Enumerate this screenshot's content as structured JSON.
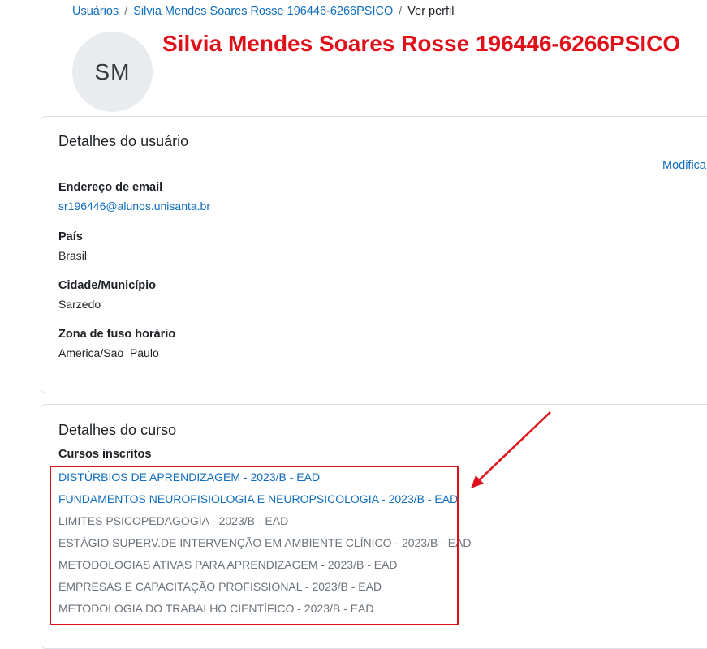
{
  "breadcrumb": {
    "items": [
      "Usuários",
      "Silvia Mendes Soares Rosse 196446-6266PSICO",
      "Ver perfil"
    ]
  },
  "profile": {
    "initials": "SM",
    "headline": "Silvia Mendes Soares Rosse 196446-6266PSICO"
  },
  "user_details": {
    "title": "Detalhes do usuário",
    "edit_label": "Modificar",
    "fields": [
      {
        "label": "Endereço de email",
        "value": "sr196446@alunos.unisanta.br"
      },
      {
        "label": "País",
        "value": "Brasil"
      },
      {
        "label": "Cidade/Município",
        "value": "Sarzedo"
      },
      {
        "label": "Zona de fuso horário",
        "value": "America/Sao_Paulo"
      }
    ]
  },
  "course_details": {
    "title": "Detalhes do curso",
    "subtitle": "Cursos inscritos",
    "courses": [
      "DISTÚRBIOS DE APRENDIZAGEM - 2023/B - EAD",
      "FUNDAMENTOS NEUROFISIOLOGIA E NEUROPSICOLOGIA - 2023/B - EAD",
      "LIMITES PSICOPEDAGOGIA - 2023/B - EAD",
      "ESTÁGIO SUPERV.DE INTERVENÇÃO EM AMBIENTE CLÍNICO - 2023/B - EAD",
      "METODOLOGIAS ATIVAS PARA APRENDIZAGEM - 2023/B - EAD",
      "EMPRESAS E CAPACITAÇÃO PROFISSIONAL - 2023/B - EAD",
      "METODOLOGIA DO TRABALHO CIENTÍFICO - 2023/B - EAD"
    ]
  },
  "colors": {
    "link": "#0f6cbf",
    "muted": "#6a737b",
    "annotation_red": "#e0101a",
    "avatar_bg": "#e9ecef"
  },
  "icons": [
    "red-annotation-arrow"
  ]
}
